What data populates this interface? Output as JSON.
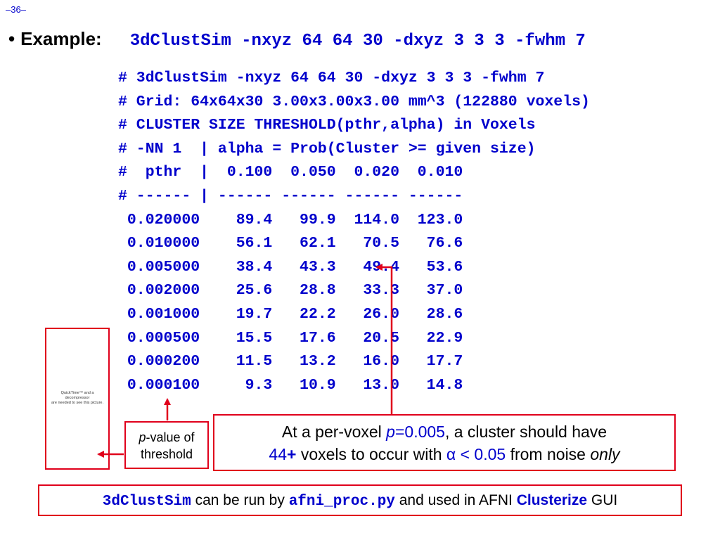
{
  "page_number": "–36–",
  "bullet": "•",
  "example_label": "Example:",
  "example_command": "3dClustSim -nxyz 64 64 30 -dxyz 3 3 3 -fwhm 7",
  "output_lines": [
    "# 3dClustSim -nxyz 64 64 30 -dxyz 3 3 3 -fwhm 7",
    "# Grid: 64x64x30 3.00x3.00x3.00 mm^3 (122880 voxels)",
    "# CLUSTER SIZE THRESHOLD(pthr,alpha) in Voxels",
    "# -NN 1  | alpha = Prob(Cluster >= given size)",
    "#  pthr  |  0.100  0.050  0.020  0.010",
    "# ------ | ------ ------ ------ ------",
    " 0.020000    89.4   99.9  114.0  123.0",
    " 0.010000    56.1   62.1   70.5   76.6",
    " 0.005000    38.4   43.3   49.4   53.6",
    " 0.002000    25.6   28.8   33.3   37.0",
    " 0.001000    19.7   22.2   26.0   28.6",
    " 0.000500    15.5   17.6   20.5   22.9",
    " 0.000200    11.5   13.2   16.0   17.7",
    " 0.000100     9.3   10.9   13.0   14.8"
  ],
  "quicktime_placeholder": {
    "line1": "QuickTime™ and a",
    "line2": "decompressor",
    "line3": "are needed to see this picture."
  },
  "pvalue_box": {
    "p": "p",
    "rest": "-value of",
    "line2": "threshold"
  },
  "note_box": {
    "t1": "At a per-voxel ",
    "p": "p",
    "eq": "=0.005",
    "t2": ", a cluster should have",
    "count": "44",
    "plus": "+",
    "t3": " voxels to occur with ",
    "alpha": "α < 0.05",
    "t4": " from noise ",
    "only": "only"
  },
  "footer": {
    "cmd1": "3dClustSim",
    "t1": " can be run by ",
    "cmd2": "afni_proc.py",
    "t2": " and used in AFNI ",
    "gui_name": "Clusterize",
    "t3": " GUI"
  },
  "colors": {
    "accent_blue": "#0000cc",
    "box_red": "#e0001b"
  }
}
